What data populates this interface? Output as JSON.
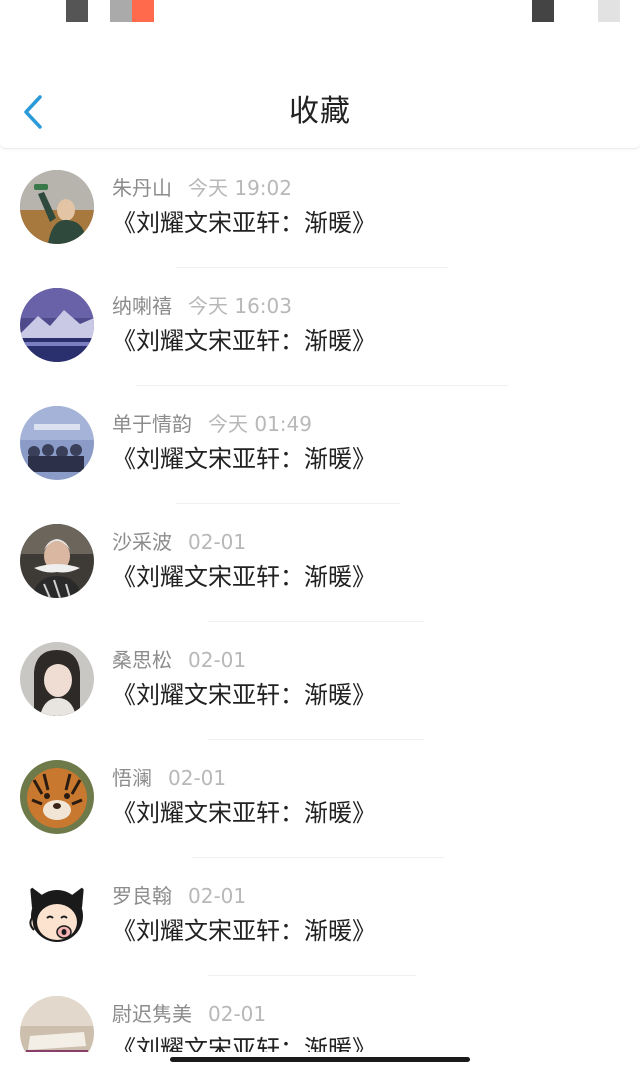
{
  "header": {
    "title": "收藏",
    "back_icon": "chevron-left-icon",
    "accent_color": "#2b9ad8"
  },
  "favorites": [
    {
      "name": "朱丹山",
      "time": "今天 19:02",
      "book": "《刘耀文宋亚轩：渐暖》"
    },
    {
      "name": "纳喇禧",
      "time": "今天 16:03",
      "book": "《刘耀文宋亚轩：渐暖》"
    },
    {
      "name": "单于情韵",
      "time": "今天 01:49",
      "book": "《刘耀文宋亚轩：渐暖》"
    },
    {
      "name": "沙采波",
      "time": "02-01",
      "book": "《刘耀文宋亚轩：渐暖》"
    },
    {
      "name": "桑思松",
      "time": "02-01",
      "book": "《刘耀文宋亚轩：渐暖》"
    },
    {
      "name": "悟澜",
      "time": "02-01",
      "book": "《刘耀文宋亚轩：渐暖》"
    },
    {
      "name": "罗良翰",
      "time": "02-01",
      "book": "《刘耀文宋亚轩：渐暖》"
    },
    {
      "name": "尉迟隽美",
      "time": "02-01",
      "book": "《刘耀文宋亚轩：渐暖》"
    }
  ]
}
